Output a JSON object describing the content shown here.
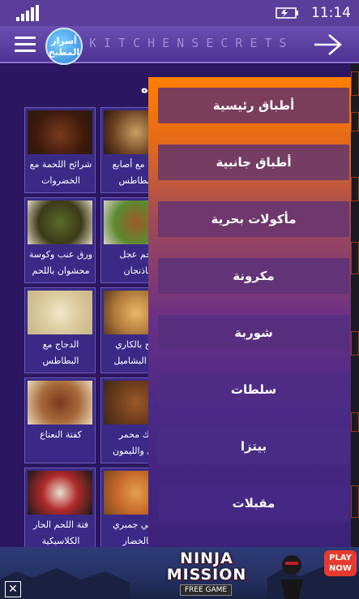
{
  "status_bar": {
    "time": "11:14"
  },
  "header": {
    "logo_text_line1": "أسرار",
    "logo_text_line2": "المطبخ",
    "brand": "KITCHENSECRETS"
  },
  "background": {
    "section_title": "ه",
    "recipes": [
      {
        "caption_line1": "شرائح اللحمة مع",
        "caption_line2": "الخضروات وصلصة"
      },
      {
        "caption_line1": "جاج مع أصابع",
        "caption_line2": "البطاطس"
      },
      {
        "caption_line1": "ورق عنب وكوسة",
        "caption_line2": "محشوان باللحم"
      },
      {
        "caption_line1": "لحم عجل",
        "caption_line2": "باذنجان"
      },
      {
        "caption_line1": "الدجاج مع",
        "caption_line2": "البطاطس"
      },
      {
        "caption_line1": "جاج بالكاري",
        "caption_line2": "ص البشاميل"
      },
      {
        "caption_line1": "كفتة النعناع",
        "caption_line2": ""
      },
      {
        "caption_line1": "نيك محمر",
        "caption_line2": "صل والليمون"
      },
      {
        "caption_line1": "فتة اللحم الحار",
        "caption_line2": "الكلاسيكية"
      },
      {
        "caption_line1": "شيني جمبري",
        "caption_line2": "بالخضار"
      }
    ]
  },
  "menu": {
    "items": [
      {
        "label": "أطباق رئيسية"
      },
      {
        "label": "أطباق جانبية"
      },
      {
        "label": "مأكولات بحرية"
      },
      {
        "label": "مكرونة"
      },
      {
        "label": "شوربة"
      },
      {
        "label": "سلطات"
      },
      {
        "label": "بيتزا"
      },
      {
        "label": "مقبلات"
      }
    ],
    "item_colors": [
      "#7a3e5a",
      "#753d62",
      "#6e386c",
      "#623376",
      "#582f7e",
      "#4f2d84",
      "#4a2b86",
      "#442884"
    ]
  },
  "ad": {
    "title_line1": "NINJA",
    "title_line2": "MISSION",
    "subtitle": "FREE GAME",
    "play_line1": "PLAY",
    "play_line2": "NOW"
  },
  "colors": {
    "accent_orange": "#ff7f00",
    "header_purple": "#5b3d9a",
    "page_bg": "#2a1760"
  }
}
